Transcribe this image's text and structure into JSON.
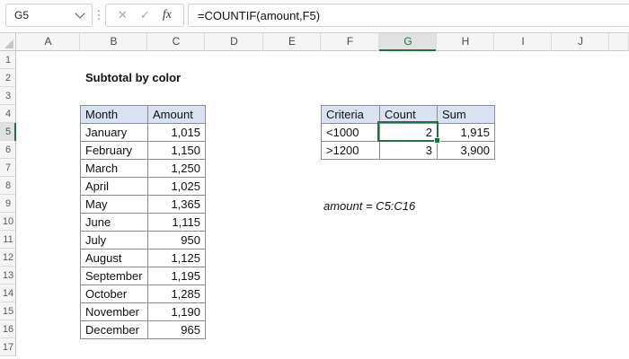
{
  "formula_bar": {
    "name_box": "G5",
    "formula": "=COUNTIF(amount,F5)",
    "fx_label": "fx",
    "cancel_glyph": "✕",
    "confirm_glyph": "✓",
    "dots_glyph": "⋮"
  },
  "grid": {
    "column_labels": [
      "A",
      "B",
      "C",
      "D",
      "E",
      "F",
      "G",
      "H",
      "I",
      "J",
      ""
    ],
    "selected_column": "G",
    "row_labels": [
      "1",
      "2",
      "3",
      "4",
      "5",
      "6",
      "7",
      "8",
      "9",
      "10",
      "11",
      "12",
      "13",
      "14",
      "15",
      "16",
      "17"
    ],
    "selected_row": "5",
    "selected_cell": "G5"
  },
  "content": {
    "title": "Subtotal by color",
    "note": "amount = C5:C16"
  },
  "month_table": {
    "headers": [
      "Month",
      "Amount"
    ],
    "rows": [
      {
        "month": "January",
        "amount": "1,015",
        "fill": "none"
      },
      {
        "month": "February",
        "amount": "1,150",
        "fill": "none"
      },
      {
        "month": "March",
        "amount": "1,250",
        "fill": "green"
      },
      {
        "month": "April",
        "amount": "1,025",
        "fill": "none"
      },
      {
        "month": "May",
        "amount": "1,365",
        "fill": "green"
      },
      {
        "month": "June",
        "amount": "1,115",
        "fill": "none"
      },
      {
        "month": "July",
        "amount": "950",
        "fill": "orange"
      },
      {
        "month": "August",
        "amount": "1,125",
        "fill": "none"
      },
      {
        "month": "September",
        "amount": "1,195",
        "fill": "none"
      },
      {
        "month": "October",
        "amount": "1,285",
        "fill": "green"
      },
      {
        "month": "November",
        "amount": "1,190",
        "fill": "none"
      },
      {
        "month": "December",
        "amount": "965",
        "fill": "orange"
      }
    ]
  },
  "criteria_table": {
    "headers": [
      "Criteria",
      "Count",
      "Sum"
    ],
    "rows": [
      {
        "criteria": "<1000",
        "count": "2",
        "sum": "1,915",
        "fill": "orange"
      },
      {
        "criteria": ">1200",
        "count": "3",
        "sum": "3,900",
        "fill": "green"
      }
    ]
  },
  "colors": {
    "header_fill": "#D9E1F2",
    "green_fill": "#E2EFDA",
    "orange_fill": "#FCEED3",
    "selection_green": "#1E7145",
    "table_border": "#8E8E8E"
  }
}
